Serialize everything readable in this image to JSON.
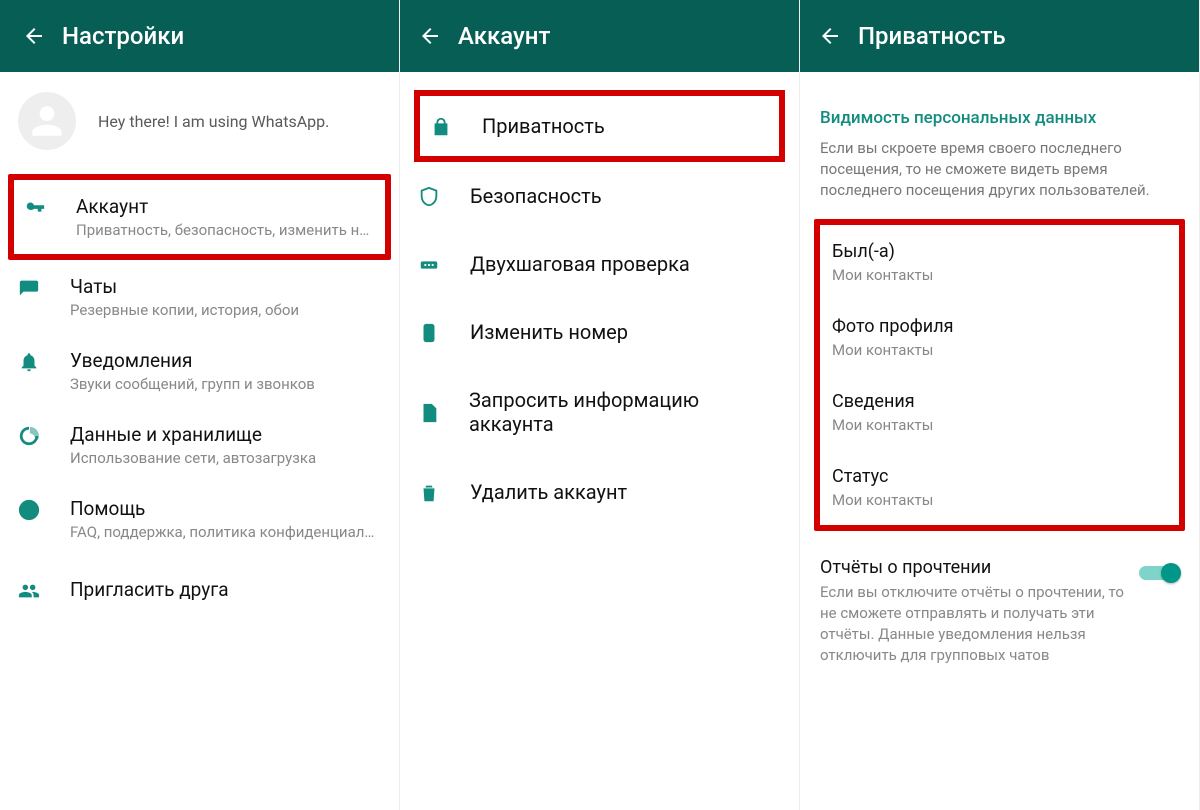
{
  "screen1": {
    "title": "Настройки",
    "profile_status": "Hey there! I am using WhatsApp.",
    "items": [
      {
        "title": "Аккаунт",
        "sub": "Приватность, безопасность, изменить номер"
      },
      {
        "title": "Чаты",
        "sub": "Резервные копии, история, обои"
      },
      {
        "title": "Уведомления",
        "sub": "Звуки сообщений, групп и звонков"
      },
      {
        "title": "Данные и хранилище",
        "sub": "Использование сети, автозагрузка"
      },
      {
        "title": "Помощь",
        "sub": "FAQ, поддержка, политика конфиденциально.."
      },
      {
        "title": "Пригласить друга"
      }
    ]
  },
  "screen2": {
    "title": "Аккаунт",
    "items": [
      "Приватность",
      "Безопасность",
      "Двухшаговая проверка",
      "Изменить номер",
      "Запросить информацию аккаунта",
      "Удалить аккаунт"
    ]
  },
  "screen3": {
    "title": "Приватность",
    "section_header": "Видимость персональных данных",
    "section_desc": "Если вы скроете время своего последнего посещения, то не сможете видеть время последнего посещения других пользователей.",
    "items": [
      {
        "title": "Был(-а)",
        "sub": "Мои контакты"
      },
      {
        "title": "Фото профиля",
        "sub": "Мои контакты"
      },
      {
        "title": "Сведения",
        "sub": "Мои контакты"
      },
      {
        "title": "Статус",
        "sub": "Мои контакты"
      }
    ],
    "read_title": "Отчёты о прочтении",
    "read_desc": "Если вы отключите отчёты о прочтении, то не сможете отправлять и получать эти отчёты. Данные уведомления нельзя отключить для групповых чатов"
  }
}
